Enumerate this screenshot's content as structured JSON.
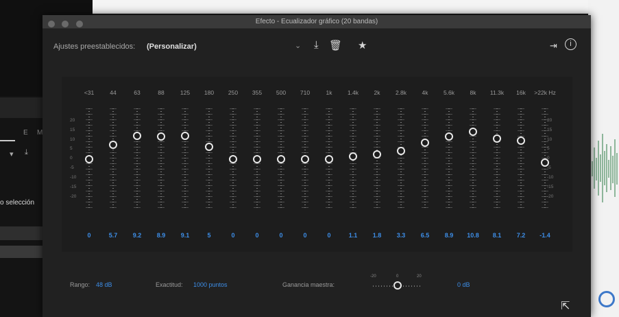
{
  "window": {
    "title": "Efecto - Ecualizador gráfico (20 bandas)"
  },
  "presets": {
    "label": "Ajustes preestablecidos:",
    "value": "(Personalizar)",
    "dropdown_icon": "chevron-down-icon",
    "icons": [
      "save-preset-icon",
      "delete-preset-icon",
      "favorite-star-icon",
      "routing-icon",
      "info-icon"
    ]
  },
  "eq": {
    "bands": [
      {
        "freq": "<31",
        "gain": "0"
      },
      {
        "freq": "44",
        "gain": "5.7"
      },
      {
        "freq": "63",
        "gain": "9.2"
      },
      {
        "freq": "88",
        "gain": "8.9"
      },
      {
        "freq": "125",
        "gain": "9.1"
      },
      {
        "freq": "180",
        "gain": "5"
      },
      {
        "freq": "250",
        "gain": "0"
      },
      {
        "freq": "355",
        "gain": "0"
      },
      {
        "freq": "500",
        "gain": "0"
      },
      {
        "freq": "710",
        "gain": "0"
      },
      {
        "freq": "1k",
        "gain": "0"
      },
      {
        "freq": "1.4k",
        "gain": "1.1"
      },
      {
        "freq": "2k",
        "gain": "1.8"
      },
      {
        "freq": "2.8k",
        "gain": "3.3"
      },
      {
        "freq": "4k",
        "gain": "6.5"
      },
      {
        "freq": "5.6k",
        "gain": "8.9"
      },
      {
        "freq": "8k",
        "gain": "10.8"
      },
      {
        "freq": "11.3k",
        "gain": "8.1"
      },
      {
        "freq": "16k",
        "gain": "7.2"
      },
      {
        "freq": ">22k",
        "gain": "-1.4"
      }
    ],
    "freq_unit": "Hz",
    "scale_labels": [
      "20",
      "15",
      "10",
      "5",
      "0",
      "-5",
      "-10",
      "-15",
      "-20"
    ],
    "range_db": [
      -20,
      20
    ]
  },
  "footer": {
    "range_label": "Rango:",
    "range_value": "48 dB",
    "accuracy_label": "Exactitud:",
    "accuracy_value": "1000 puntos",
    "master_gain_label": "Ganancia maestra:",
    "master_gain_ticks": [
      "-20",
      "0",
      "20"
    ],
    "master_gain_value": "0 dB"
  },
  "background": {
    "left_tabs": [
      "E",
      "M"
    ],
    "selection_label": "o selección"
  }
}
